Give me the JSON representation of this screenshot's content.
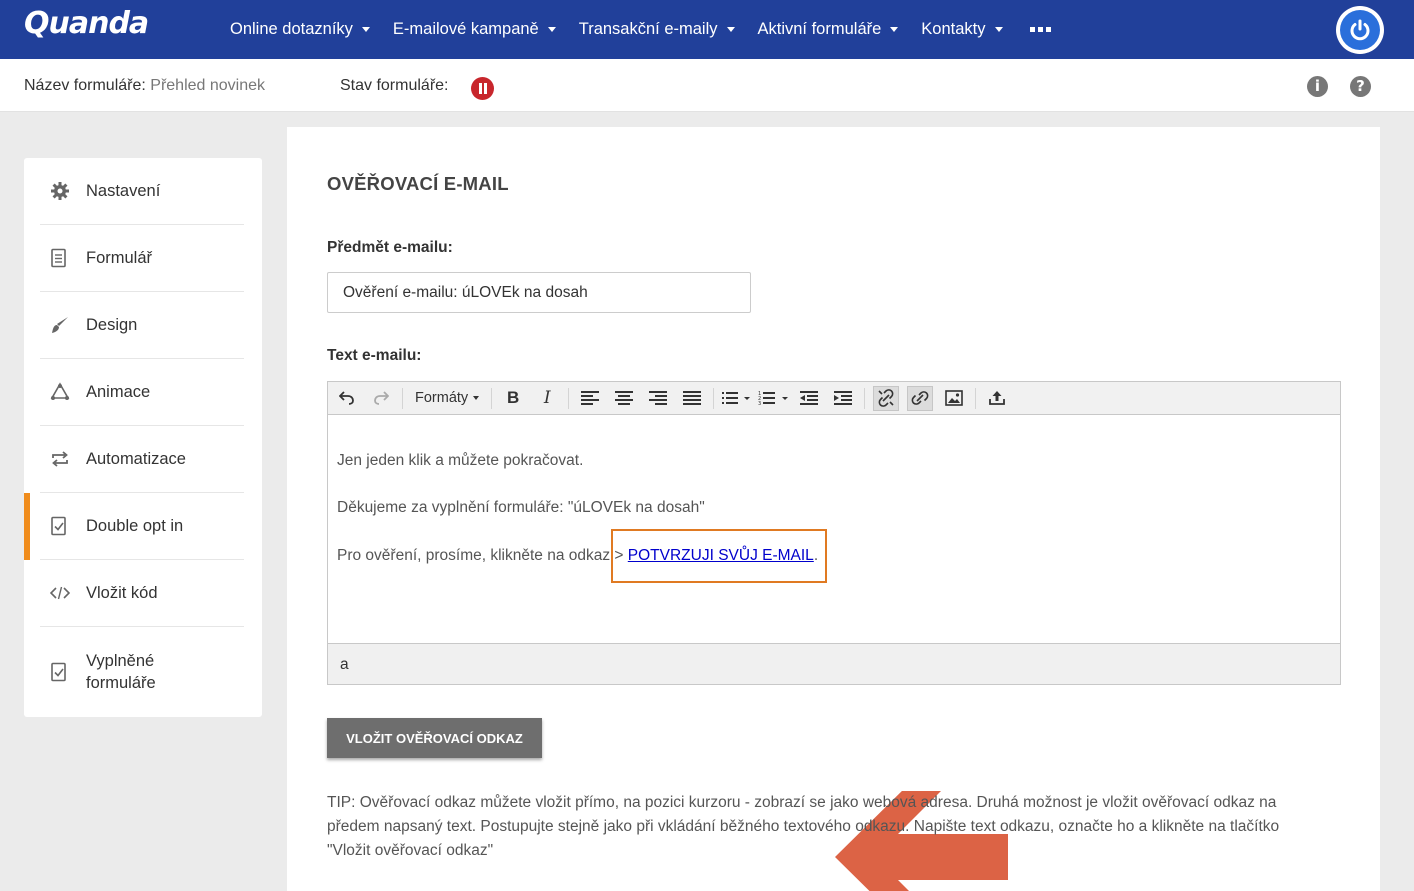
{
  "brand": {
    "logo": "Quanda",
    "accent": "#21409a",
    "highlight": "#e07a22"
  },
  "nav": {
    "items": [
      "Online dotazníky",
      "E-mailové kampaně",
      "Transakční e-maily",
      "Aktivní formuláře",
      "Kontakty"
    ]
  },
  "subheader": {
    "name_label": "Název formuláře:",
    "name_value": "Přehled novinek",
    "status_label": "Stav formuláře:",
    "info_icon": "i",
    "help_icon": "?"
  },
  "sidebar": {
    "items": [
      {
        "label": "Nastavení",
        "icon": "gear-icon"
      },
      {
        "label": "Formulář",
        "icon": "document-icon"
      },
      {
        "label": "Design",
        "icon": "brush-icon"
      },
      {
        "label": "Animace",
        "icon": "animation-icon"
      },
      {
        "label": "Automatizace",
        "icon": "repeat-icon"
      },
      {
        "label": "Double opt in",
        "icon": "check-document-icon"
      },
      {
        "label": "Vložit kód",
        "icon": "code-icon"
      },
      {
        "label": "Vyplněné formuláře",
        "icon": "filled-forms-icon"
      }
    ],
    "active_index": 5
  },
  "main": {
    "title": "OVĚŘOVACÍ E-MAIL",
    "subject_label": "Předmět e-mailu:",
    "subject_value": "Ověření e-mailu: úLOVEk na dosah",
    "text_label": "Text e-mailu:",
    "toolbar": {
      "formats": "Formáty",
      "bold": "B",
      "italic": "I"
    },
    "body": {
      "p1": "Jen jeden klik a můžete pokračovat.",
      "p2": "Děkujeme za vyplnění formuláře: \"úLOVEk na dosah\"",
      "p3_prefix": "Pro ověření, prosíme, klikněte na odkaz > ",
      "p3_link": "POTVRZUJI SVŮJ E-MAIL",
      "p3_suffix": "."
    },
    "status_path": "a",
    "insert_button": "VLOŽIT OVĚŘOVACÍ ODKAZ",
    "tip": "TIP: Ověřovací odkaz můžete vložit přímo, na pozici kurzoru - zobrazí se jako webová adresa. Druhá možnost je vložit ověřovací odkaz na předem napsaný text. Postupujte stejně jako při vkládání běžného textového odkazu. Napište text odkazu, označte ho a klikněte na tlačítko \"Vložit ověřovací odkaz\""
  }
}
